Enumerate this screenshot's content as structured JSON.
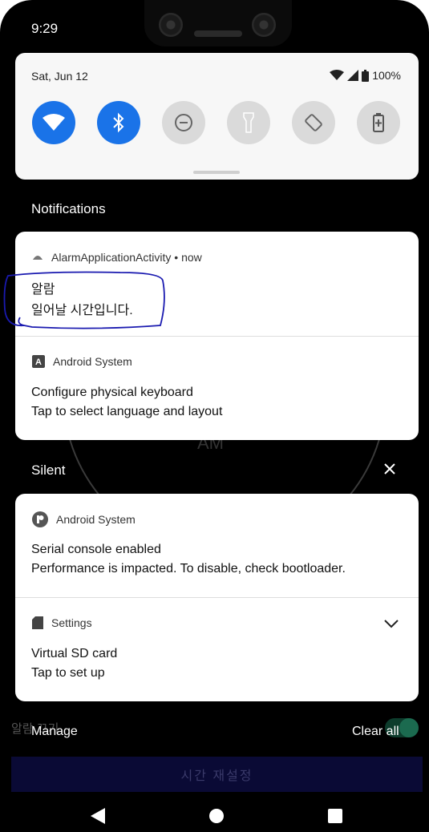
{
  "status_bar": {
    "time": "9:29"
  },
  "quick_settings": {
    "date": "Sat, Jun 12",
    "battery": "100%",
    "tiles": [
      {
        "name": "wifi",
        "state": "on"
      },
      {
        "name": "bluetooth",
        "state": "on"
      },
      {
        "name": "do-not-disturb",
        "state": "off"
      },
      {
        "name": "flashlight",
        "state": "off"
      },
      {
        "name": "auto-rotate",
        "state": "off"
      },
      {
        "name": "battery-saver",
        "state": "off"
      }
    ]
  },
  "notifications_header": "Notifications",
  "alerting": [
    {
      "app": "AlarmApplicationActivity • now",
      "title": "알람",
      "body": "일어날 시간입니다."
    },
    {
      "app": "Android System",
      "title": "Configure physical keyboard",
      "body": "Tap to select language and layout"
    }
  ],
  "silent_header": "Silent",
  "silent": [
    {
      "app": "Android System",
      "title": "Serial console enabled",
      "body": "Performance is impacted. To disable, check bootloader."
    },
    {
      "app": "Settings",
      "title": "Virtual SD card",
      "body": "Tap to set up"
    }
  ],
  "footer": {
    "manage": "Manage",
    "clear_all": "Clear all"
  },
  "background_app": {
    "am_label": "AM",
    "alarm_off_label": "알람 끄기",
    "reset_button": "시간 재설정"
  },
  "colors": {
    "accent": "#1a73e8",
    "annotation": "#1a1ab0"
  }
}
